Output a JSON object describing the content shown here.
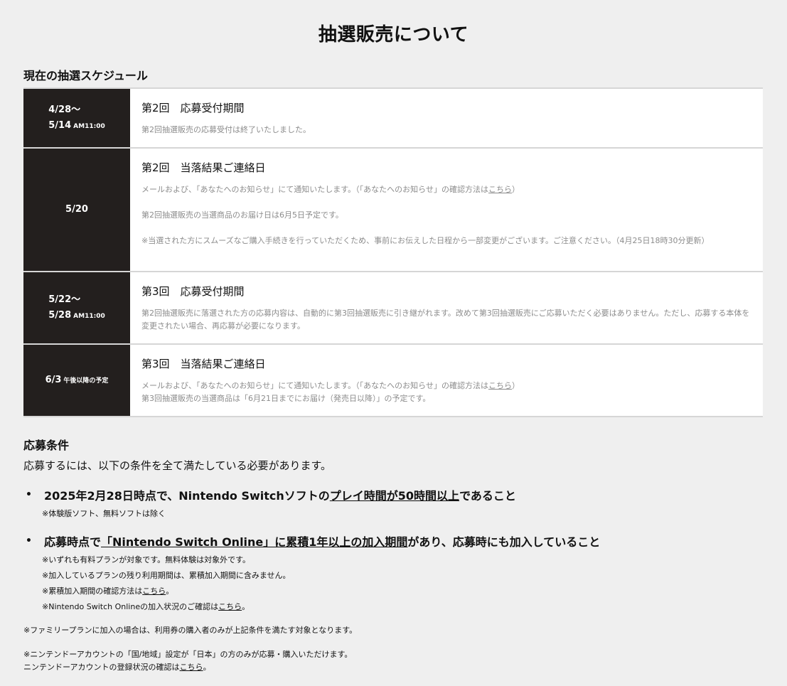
{
  "page_title": "抽選販売について",
  "schedule_heading": "現在の抽選スケジュール",
  "schedule": [
    {
      "date_line1": "4/28〜",
      "date_line2": "5/14",
      "date_small": "AM11:00",
      "title": "第2回　応募受付期間",
      "text1": "第2回抽選販売の応募受付は終了いたしました。"
    },
    {
      "date_line1": "5/20",
      "title": "第2回　当落結果ご連絡日",
      "text1_prefix": "メールおよび、「あなたへのお知らせ」にて通知いたします。（「あなたへのお知らせ」の確認方法は",
      "text1_link": "こちら",
      "text1_suffix": "）",
      "text2": "第2回抽選販売の当選商品のお届け日は6月5日予定です。",
      "text3": "※当選された方にスムーズなご購入手続きを行っていただくため、事前にお伝えした日程から一部変更がございます。ご注意ください。（4月25日18時30分更新）"
    },
    {
      "date_line1": "5/22〜",
      "date_line2": "5/28",
      "date_small": "AM11:00",
      "title": "第3回　応募受付期間",
      "text1": "第2回抽選販売に落選された方の応募内容は、自動的に第3回抽選販売に引き継がれます。改めて第3回抽選販売にご応募いただく必要はありません。ただし、応募する本体を変更されたい場合、再応募が必要になります。"
    },
    {
      "date_line1": "6/3",
      "date_small": "午後以降の予定",
      "title": "第3回　当落結果ご連絡日",
      "text1_prefix": "メールおよび、「あなたへのお知らせ」にて通知いたします。（「あなたへのお知らせ」の確認方法は",
      "text1_link": "こちら",
      "text1_suffix": "）",
      "text2": "第3回抽選販売の当選商品は「6月21日までにお届け（発売日以降）」の予定です。"
    }
  ],
  "conditions_heading": "応募条件",
  "conditions_intro": "応募するには、以下の条件を全て満たしている必要があります。",
  "condition1": {
    "part1": "2025年2月28日時点で、Nintendo Switchソフトの",
    "part2": "プレイ時間が50時間以上",
    "part3": "であること",
    "note1": "※体験版ソフト、無料ソフトは除く"
  },
  "condition2": {
    "part1": "応募時点で",
    "part2": "「Nintendo Switch Online」に累積1年以上の加入期間",
    "part3": "があり、応募時にも加入していること",
    "note1": "※いずれも有料プランが対象です。無料体験は対象外です。",
    "note2": "※加入しているプランの残り利用期間は、累積加入期間に含みません。",
    "note3_prefix": "※累積加入期間の確認方法は",
    "note3_link": "こちら",
    "note3_suffix": "。",
    "note4_prefix": "※Nintendo Switch Onlineの加入状況のご確認は",
    "note4_link": "こちら",
    "note4_suffix": "。"
  },
  "footnote1": "※ファミリープランに加入の場合は、利用券の購入者のみが上記条件を満たす対象となります。",
  "footnote2": "※ニンテンドーアカウントの「国/地域」設定が「日本」の方のみが応募・購入いただけます。",
  "footnote3_prefix": "ニンテンドーアカウントの登録状況の確認は",
  "footnote3_link": "こちら",
  "footnote3_suffix": "。"
}
